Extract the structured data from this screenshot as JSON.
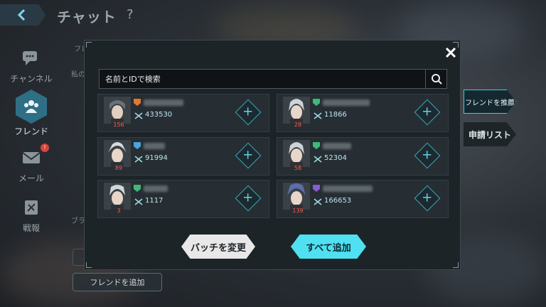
{
  "header": {
    "title": "チャット",
    "help": "?"
  },
  "nav": [
    {
      "label": "チャンネル",
      "icon": "chat-bubble-icon"
    },
    {
      "label": "フレンド",
      "icon": "friends-icon",
      "active": true
    },
    {
      "label": "メール",
      "icon": "mail-icon",
      "notification": "!"
    },
    {
      "label": "戦報",
      "icon": "battle-report-icon"
    }
  ],
  "background": {
    "tab_label": "フレン",
    "my_label": "私の",
    "blacklist_label": "ブラ",
    "add_friend_label": "フレンドを追加"
  },
  "side_tabs": {
    "recommend": "フレンドを推薦",
    "requests": "申請リスト"
  },
  "modal": {
    "search_placeholder": "名前とIDで検索",
    "change_batch": "バッチを変更",
    "add_all": "すべて追加",
    "friends": [
      {
        "level": "156",
        "power": "433530",
        "badge_color": "#e07a2e",
        "hair": "#6a7076"
      },
      {
        "level": "28",
        "power": "11866",
        "badge_color": "#3fb878",
        "hair": "#cfd3d6"
      },
      {
        "level": "89",
        "power": "91994",
        "badge_color": "#4aa4d8",
        "hair": "#d9dcde"
      },
      {
        "level": "58",
        "power": "52304",
        "badge_color": "#3fb878",
        "hair": "#cfd3d6"
      },
      {
        "level": "3",
        "power": "1117",
        "badge_color": "#3fb878",
        "hair": "#d2d5d8"
      },
      {
        "level": "139",
        "power": "166653",
        "badge_color": "#8a5ad0",
        "hair": "#5b6ea8"
      }
    ]
  }
}
